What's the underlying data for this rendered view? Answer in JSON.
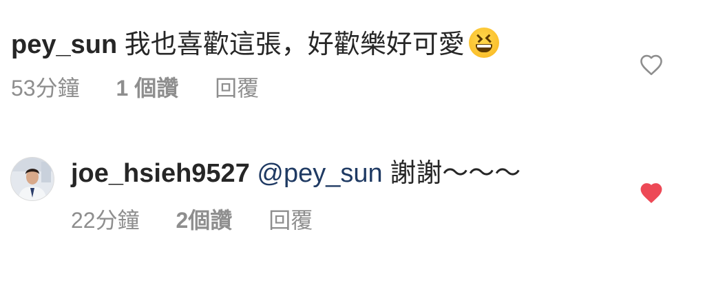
{
  "comments": [
    {
      "username": "pey_sun",
      "text": "我也喜歡這張，好歡樂好可愛",
      "emoji": "grinning-squinting-face",
      "time": "53分鐘",
      "likes": "1 個讚",
      "reply_label": "回覆",
      "liked": false
    },
    {
      "username": "joe_hsieh9527",
      "mention": "@pey_sun",
      "text": "謝謝～～～",
      "time": "22分鐘",
      "likes": "2個讚",
      "reply_label": "回覆",
      "liked": true
    }
  ],
  "colors": {
    "text": "#262626",
    "meta": "#8e8e8e",
    "mention": "#1f3a63",
    "heart_liked": "#ed4956",
    "heart_outline": "#8e8e8e"
  },
  "icons": {
    "like_outline": "heart-outline-icon",
    "like_filled": "heart-filled-icon"
  }
}
